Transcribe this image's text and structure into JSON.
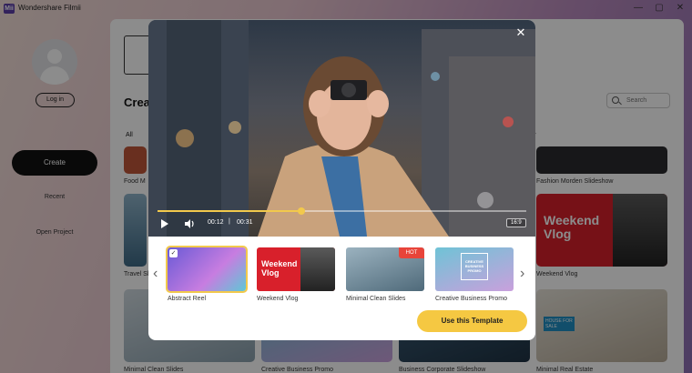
{
  "app": {
    "title": "Wondershare Filmii",
    "logo_text": "Mii"
  },
  "window_controls": {
    "minimize": "—",
    "restore": "▢",
    "close": "✕"
  },
  "sidebar": {
    "login_label": "Log in",
    "create_label": "Create",
    "recent_label": "Recent",
    "open_project_label": "Open Project"
  },
  "main": {
    "heading": "Crea",
    "search_placeholder": "Search",
    "category_all": "All",
    "category_partial_left": "R",
    "category_partial_right": "y",
    "cards": {
      "food": "Food M",
      "fashion": "Fashion Morden Slideshow",
      "travel": "Travel Sl",
      "weekend": "Weekend Vlog",
      "weekend_title": "Weekend Vlog",
      "bottom_minimal": "Minimal Clean Slides",
      "bottom_creative": "Creative Business Promo",
      "bottom_corporate": "Business Corporate Slideshow",
      "bottom_realestate": "Minimal Real Estate",
      "realestate_text": "HOUSE FOR SALE"
    }
  },
  "modal": {
    "close": "✕",
    "player": {
      "time_current": "00:12",
      "separator": "|",
      "time_total": "00:31",
      "aspect_ratio": "16:9",
      "progress": 0.39
    },
    "templates": [
      {
        "label": "Abstract Reel",
        "selected": true,
        "hot": false
      },
      {
        "label": "Weekend Vlog",
        "selected": false,
        "hot": false,
        "thumb_text": "Weekend Vlog"
      },
      {
        "label": "Minimal Clean Slides",
        "selected": false,
        "hot": true
      },
      {
        "label": "Creative Business Promo",
        "selected": false,
        "hot": false,
        "thumb_text": "CREATIVE BUSINESS PROMO"
      }
    ],
    "hot_badge": "HOT",
    "check": "✓",
    "prev_arrow": "‹",
    "next_arrow": "›",
    "use_button": "Use this Template"
  },
  "colors": {
    "accent": "#f5c842",
    "create_button": "#111111",
    "hot": "#e8443a",
    "weekend_red": "#d8202b"
  }
}
